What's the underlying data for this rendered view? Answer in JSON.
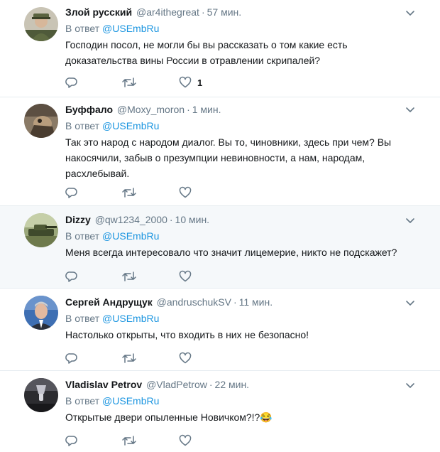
{
  "reply_prefix": "В ответ",
  "reply_handle": "@USEmbRu",
  "tweets": [
    {
      "name": "Злой русский",
      "handle": "@ar4ithegreat",
      "time": "57 мин.",
      "text": "Господин посол, не могли бы вы рассказать о том какие есть доказательства вины России в отравлении скрипалей?",
      "like_count": "1"
    },
    {
      "name": "Буффало",
      "handle": "@Moxy_moron",
      "time": "1 мин.",
      "text": "Так это  народ с народом диалог.  Вы то, чиновники, здесь при чем? Вы накосячили, забыв о презумпции невиновности,  а нам, народам, расхлебывай.",
      "like_count": ""
    },
    {
      "name": "Dizzy",
      "handle": "@qw1234_2000",
      "time": "10 мин.",
      "text": "Меня всегда интересовало что значит лицемерие, никто не подскажет?",
      "like_count": ""
    },
    {
      "name": "Сергей Андрущук",
      "handle": "@andruschukSV",
      "time": "11 мин.",
      "text": "Настолько открыты, что входить в них не безопасно!",
      "like_count": ""
    },
    {
      "name": "Vladislav Petrov",
      "handle": "@VladPetrow",
      "time": "22 мин.",
      "text": "Открытые двери опыленные Новичком?!?😂",
      "like_count": ""
    }
  ],
  "colors": {
    "link": "#1b95e0",
    "secondary": "#657786",
    "highlight_bg": "#f5f8fa",
    "divider": "#e6ecf0"
  }
}
